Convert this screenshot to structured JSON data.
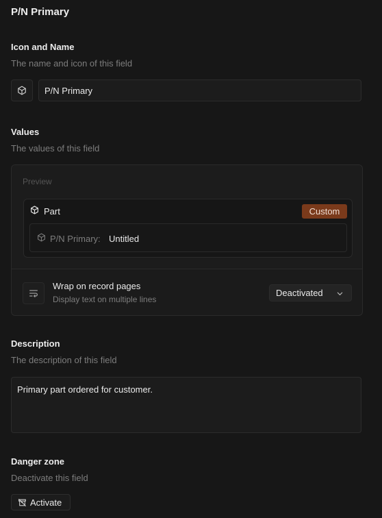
{
  "header": {
    "title": "P/N Primary"
  },
  "icon_name": {
    "title": "Icon and Name",
    "description": "The name and icon of this field",
    "icon": "cube-icon",
    "name_value": "P/N Primary"
  },
  "values": {
    "title": "Values",
    "description": "The values of this field",
    "preview": {
      "label": "Preview",
      "record_icon": "cube-icon",
      "record_name": "Part",
      "badge": "Custom",
      "badge_color": "#7a3a1b",
      "field_label": "P/N Primary:",
      "field_value": "Untitled"
    },
    "wrap": {
      "icon": "text-wrap-icon",
      "title": "Wrap on record pages",
      "description": "Display text on multiple lines",
      "selected": "Deactivated"
    }
  },
  "description": {
    "title": "Description",
    "subtitle": "The description of this field",
    "value": "Primary part ordered for customer."
  },
  "danger": {
    "title": "Danger zone",
    "description": "Deactivate this field",
    "button_icon": "archive-off-icon",
    "button_label": "Activate"
  }
}
